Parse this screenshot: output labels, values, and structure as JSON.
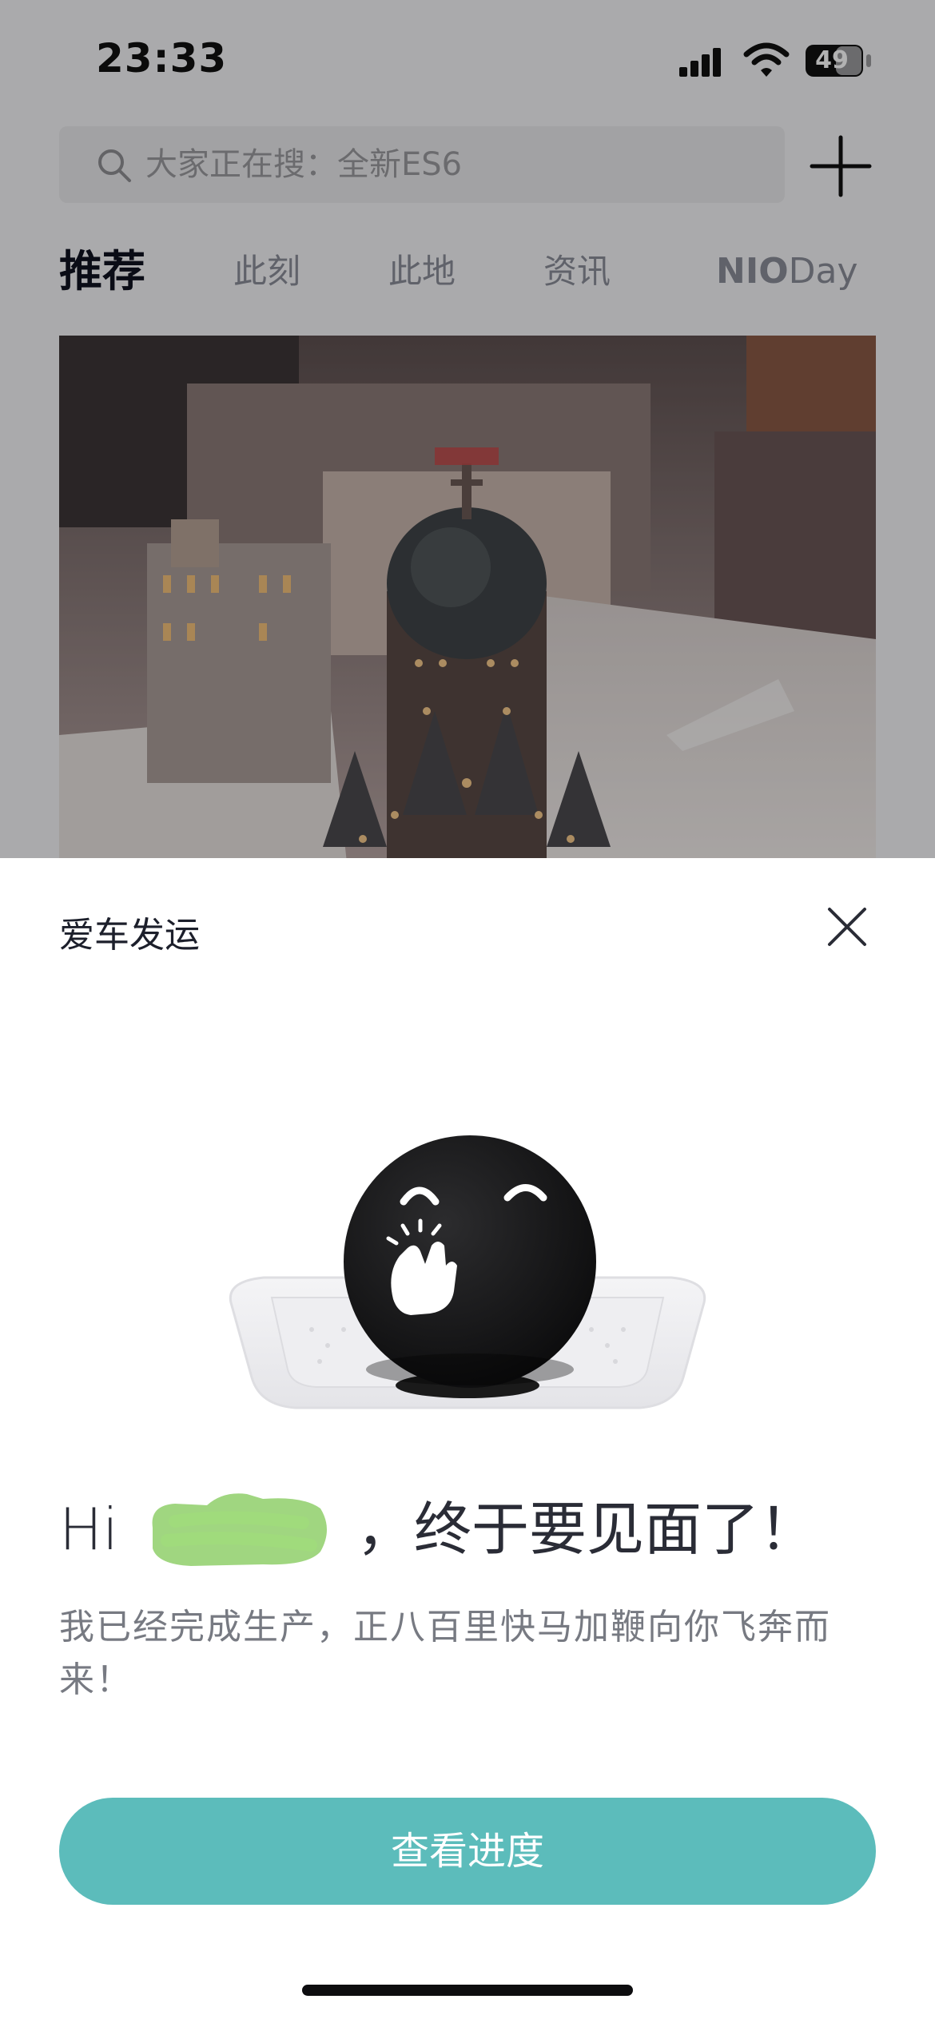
{
  "status_bar": {
    "time": "23:33",
    "battery": "49",
    "signal_icon": "cellular-signal-icon",
    "wifi_icon": "wifi-icon"
  },
  "header": {
    "search_placeholder": "大家正在搜：全新ES6",
    "search_icon": "search-icon",
    "add_icon": "plus-icon"
  },
  "tabs": [
    {
      "label": "推荐",
      "active": true
    },
    {
      "label": "此刻",
      "active": false
    },
    {
      "label": "此地",
      "active": false
    },
    {
      "label": "资讯",
      "active": false
    }
  ],
  "nioday_tab": {
    "bold": "NIO",
    "light": "Day"
  },
  "sheet": {
    "title": "爱车发运",
    "close_icon": "close-icon",
    "greeting_prefix": "Hi",
    "greeting_suffix": "，终于要见面了！",
    "message": "我已经完成生产，正八百里快马加鞭向你飞奔而来！",
    "button_label": "查看进度"
  },
  "colors": {
    "accent": "#5cbcbb",
    "title_text": "#1c1f2b",
    "body_text": "#777a82",
    "redaction": "#8fcf6a"
  }
}
